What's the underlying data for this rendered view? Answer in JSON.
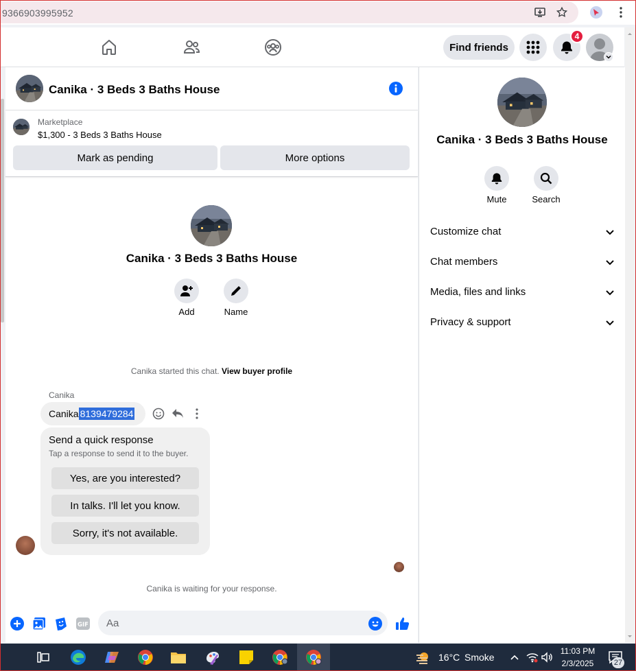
{
  "browser": {
    "url": "9366903995952"
  },
  "nav": {
    "find_friends": "Find friends",
    "notification_count": "4"
  },
  "chat": {
    "title": "Canika · 3 Beds 3 Baths House",
    "marketplace_label": "Marketplace",
    "listing": "$1,300 - 3 Beds 3 Baths House",
    "mark_pending": "Mark as pending",
    "more_options": "More options",
    "group_title": "Canika · 3 Beds 3 Baths House",
    "add_label": "Add",
    "name_label": "Name",
    "started_text": "Canika started this chat.",
    "view_profile": "View buyer profile",
    "sender_name": "Canika",
    "message_prefix": "Canika",
    "message_highlight": "8139479284",
    "quick_title": "Send a quick response",
    "quick_sub": "Tap a response to send it to the buyer.",
    "quick_responses": [
      "Yes, are you interested?",
      "In talks. I'll let you know.",
      "Sorry, it's not available."
    ],
    "waiting_text": "Canika is waiting for your response.",
    "composer_placeholder": "Aa"
  },
  "info": {
    "title": "Canika · 3 Beds 3 Baths House",
    "mute_label": "Mute",
    "search_label": "Search",
    "sections": [
      "Customize chat",
      "Chat members",
      "Media, files and links",
      "Privacy & support"
    ]
  },
  "taskbar": {
    "weather_temp": "16°C",
    "weather_desc": "Smoke",
    "time": "11:03 PM",
    "date": "2/3/2025",
    "notif_count": "27"
  },
  "colors": {
    "fb_blue": "#0866ff",
    "badge_red": "#e41e3f",
    "highlight": "#2f6ddb"
  }
}
